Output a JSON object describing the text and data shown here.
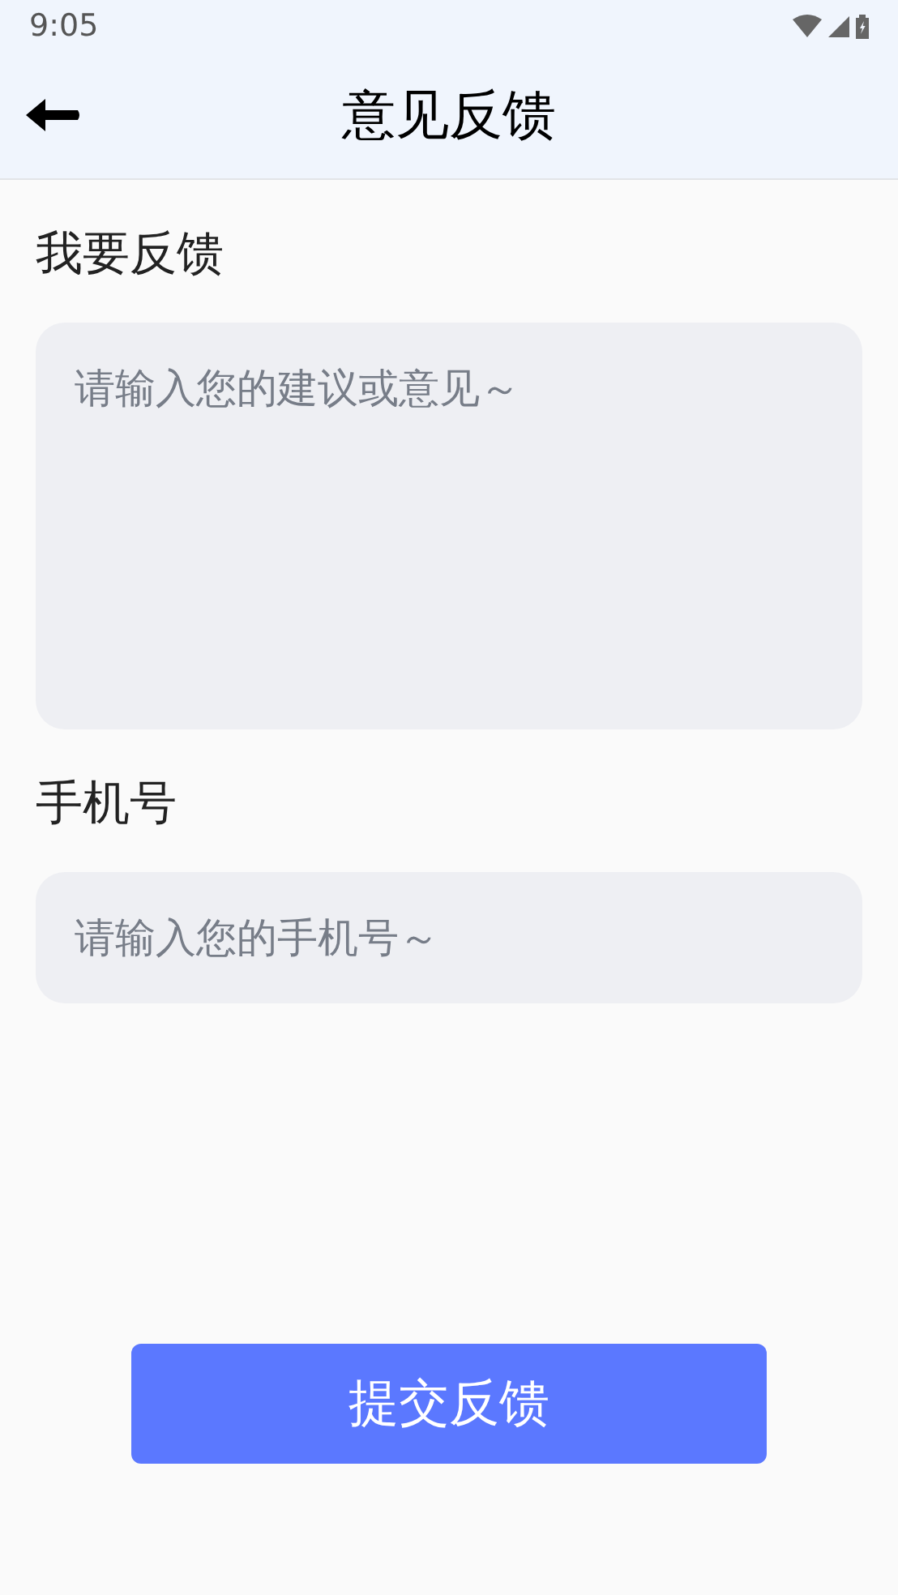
{
  "status_bar": {
    "time": "9:05"
  },
  "header": {
    "title": "意见反馈"
  },
  "form": [
    {
      "kind": "textarea",
      "label": "我要反馈",
      "placeholder": "请输入您的建议或意见～"
    },
    {
      "kind": "input",
      "label": "手机号",
      "placeholder": "请输入您的手机号～"
    }
  ],
  "submit_button": "提交反馈"
}
